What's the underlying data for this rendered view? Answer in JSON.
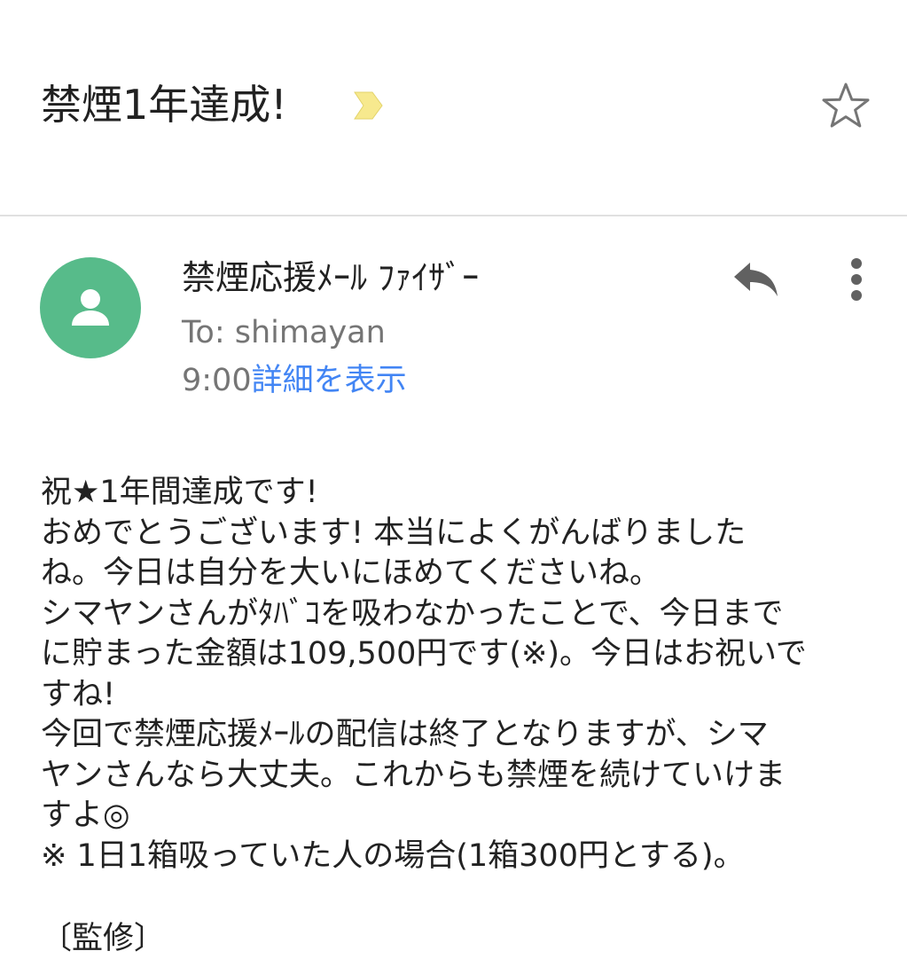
{
  "message": {
    "subject": "禁煙1年達成!",
    "sender": "禁煙応援ﾒｰﾙ ﾌｧｲｻﾞｰ",
    "recipient": "To: shimayan",
    "time": "9:00",
    "details_link": "詳細を表示",
    "body_lines": [
      "祝★1年間達成です!",
      "おめでとうございます! 本当によくがんばりました",
      "ね。今日は自分を大いにほめてくださいね。",
      "シマヤンさんがﾀﾊﾞｺを吸わなかったことで、今日まで",
      "に貯まった金額は109,500円です(※)。今日はお祝いで",
      "すね!",
      "今回で禁煙応援ﾒｰﾙの配信は終了となりますが、シマ",
      "ヤンさんなら大丈夫。これからも禁煙を続けていけま",
      "すよ◎",
      "※ 1日1箱吸っていた人の場合(1箱300円とする)。"
    ],
    "supervision_label": "〔監修〕"
  },
  "icons": {
    "importance": "importance-marker-icon",
    "star": "star-icon",
    "avatar": "person-icon",
    "reply": "reply-icon",
    "more": "more-vertical-icon"
  },
  "colors": {
    "avatar_bg": "#57bb8a",
    "importance": "#f7e98e",
    "link": "#4285f4",
    "secondary_text": "#757575"
  }
}
